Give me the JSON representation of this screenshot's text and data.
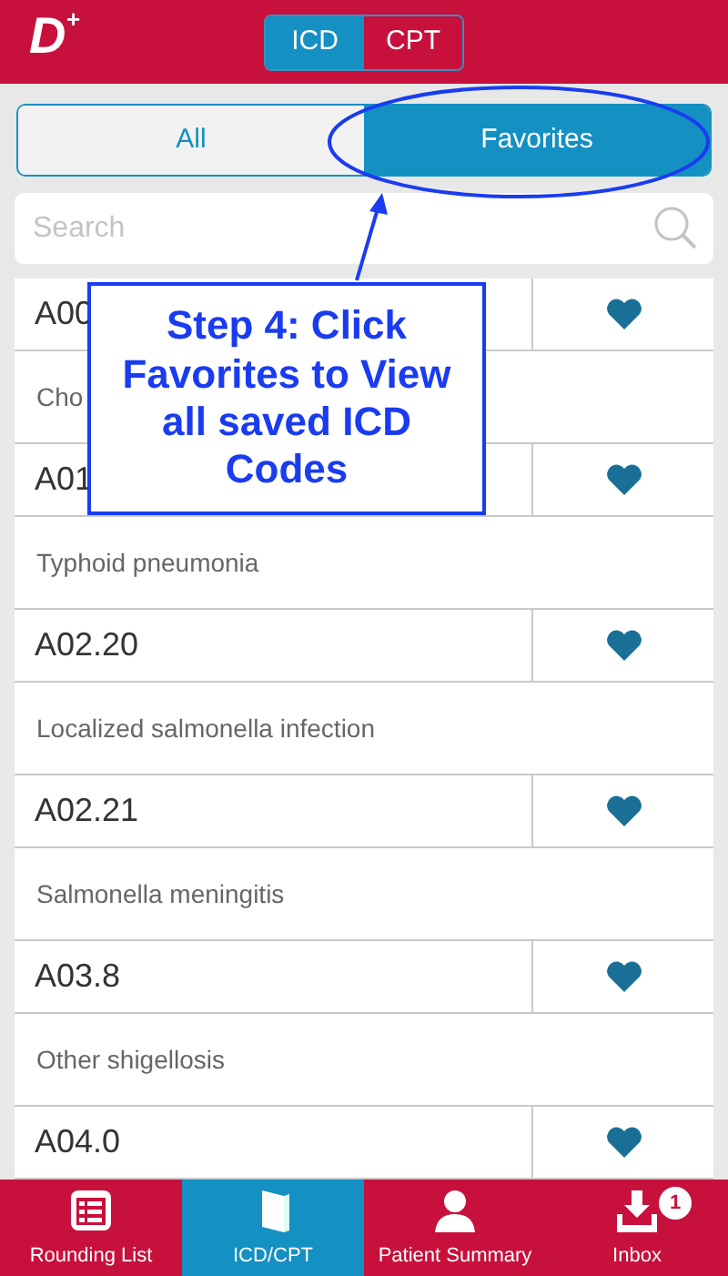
{
  "header": {
    "logo_letter": "D",
    "logo_mark": "+",
    "segments": [
      {
        "label": "ICD",
        "selected": true
      },
      {
        "label": "CPT",
        "selected": false
      }
    ]
  },
  "filter_tabs": [
    {
      "label": "All",
      "selected": false
    },
    {
      "label": "Favorites",
      "selected": true
    }
  ],
  "search": {
    "placeholder": "Search"
  },
  "codes": [
    {
      "code": "A00",
      "description": "Cho",
      "favorite": true
    },
    {
      "code": "A01",
      "description": "Typhoid pneumonia",
      "favorite": true
    },
    {
      "code": "A02.20",
      "description": "Localized salmonella infection",
      "favorite": true
    },
    {
      "code": "A02.21",
      "description": "Salmonella meningitis",
      "favorite": true
    },
    {
      "code": "A03.8",
      "description": "Other shigellosis",
      "favorite": true
    },
    {
      "code": "A04.0",
      "favorite": true
    }
  ],
  "annotation": {
    "text": "Step 4: Click Favorites to View all saved ICD Codes"
  },
  "tab_bar": [
    {
      "label": "Rounding List",
      "selected": false
    },
    {
      "label": "ICD/CPT",
      "selected": true
    },
    {
      "label": "Patient Summary",
      "selected": false
    },
    {
      "label": "Inbox",
      "selected": false,
      "badge": "1"
    }
  ]
}
